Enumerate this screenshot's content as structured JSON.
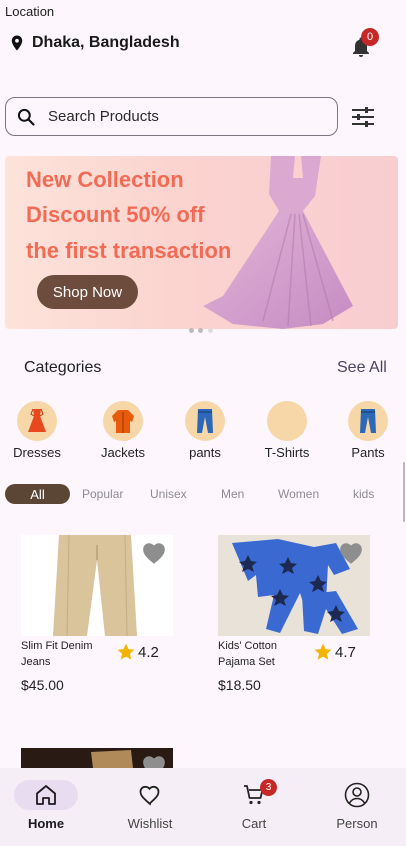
{
  "header": {
    "location_label": "Location",
    "location_name": "Dhaka, Bangladesh",
    "notification_count": "0"
  },
  "search": {
    "placeholder": "Search Products"
  },
  "banner": {
    "line1": "New Collection",
    "line2": "Discount 50% off",
    "line3": "the first transaction",
    "cta": "Shop Now",
    "accent_color": "#f26b55"
  },
  "categories": {
    "title": "Categories",
    "see_all": "See All",
    "items": [
      {
        "label": "Dresses",
        "icon": "dress-icon"
      },
      {
        "label": "Jackets",
        "icon": "jacket-icon"
      },
      {
        "label": "pants",
        "icon": "pants-icon"
      },
      {
        "label": "T-Shirts",
        "icon": "tshirt-icon"
      },
      {
        "label": "Pants",
        "icon": "pants-icon"
      }
    ]
  },
  "filters": {
    "items": [
      "All",
      "Popular",
      "Unisex",
      "Men",
      "Women",
      "kids"
    ],
    "selected": "All"
  },
  "products": [
    {
      "name": "Slim Fit Denim Jeans",
      "rating": "4.2",
      "price": "$45.00"
    },
    {
      "name": "Kids' Cotton Pajama Set",
      "rating": "4.7",
      "price": "$18.50"
    }
  ],
  "nav": {
    "home": "Home",
    "wishlist": "Wishlist",
    "cart": "Cart",
    "cart_count": "3",
    "person": "Person"
  }
}
